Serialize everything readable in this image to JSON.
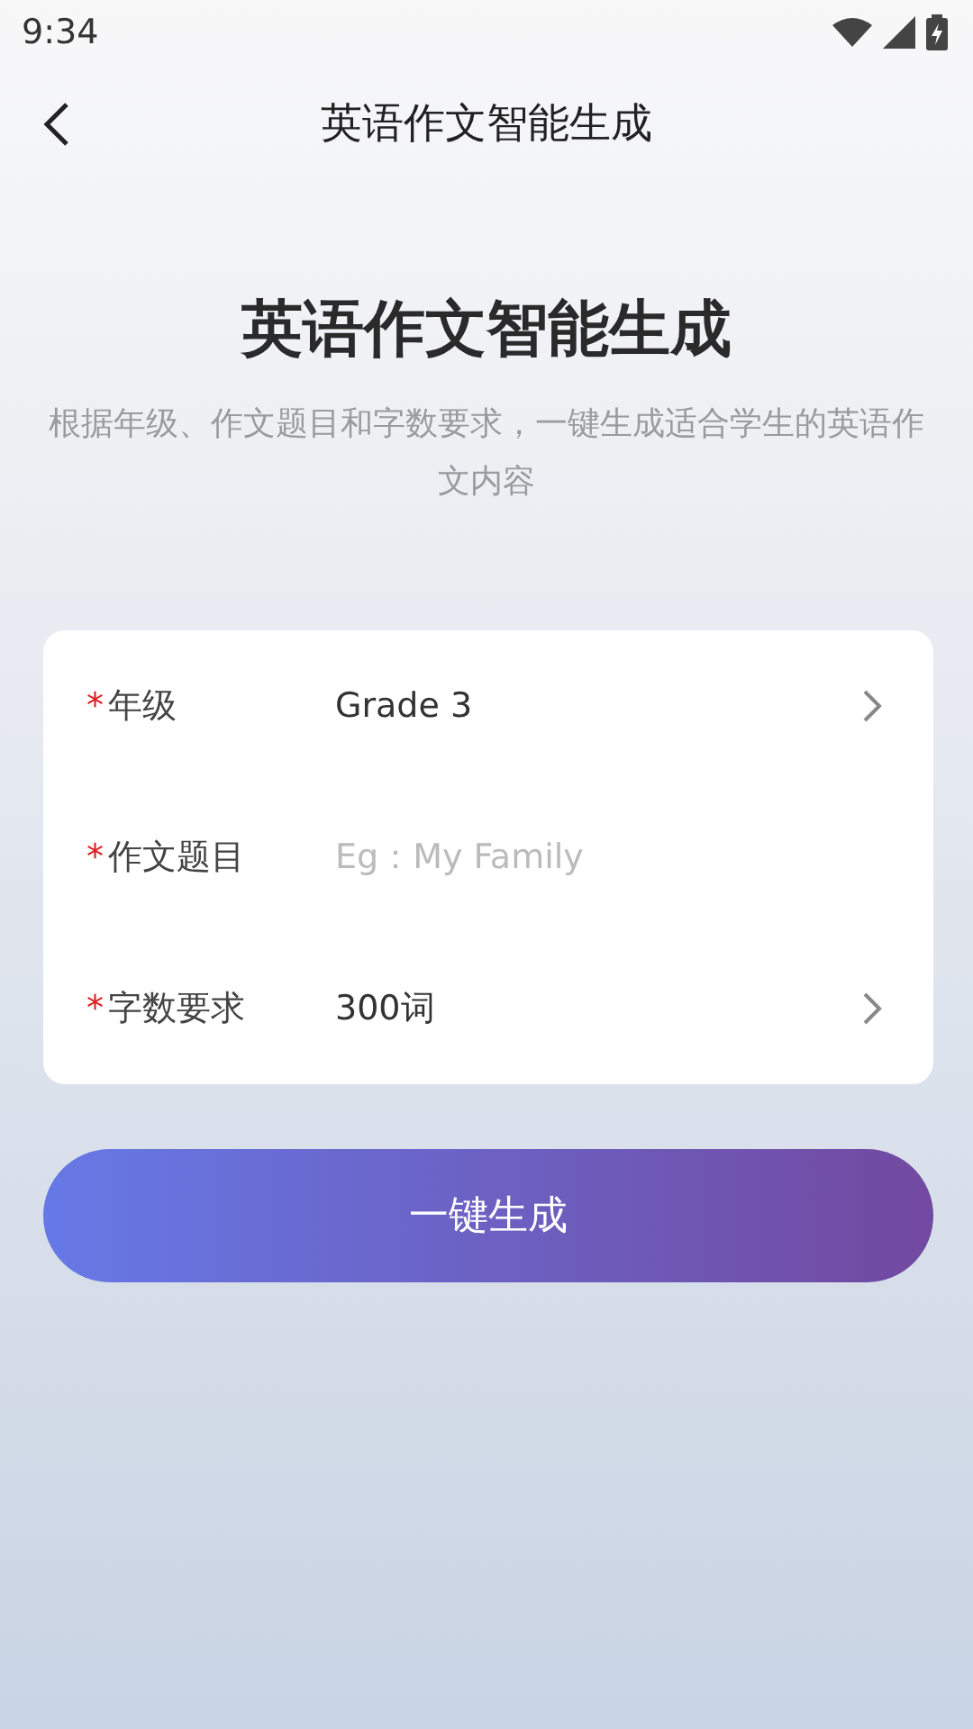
{
  "status_bar": {
    "time": "9:34"
  },
  "header": {
    "title": "英语作文智能生成"
  },
  "hero": {
    "title": "英语作文智能生成",
    "subtitle": "根据年级、作文题目和字数要求，一键生成适合学生的英语作文内容"
  },
  "form": {
    "fields": [
      {
        "kind": "select",
        "required_mark": "*",
        "label": "年级",
        "value": "Grade 3"
      },
      {
        "kind": "input",
        "required_mark": "*",
        "label": "作文题目",
        "placeholder": "Eg：My Family"
      },
      {
        "kind": "select",
        "required_mark": "*",
        "label": "字数要求",
        "value": "300词"
      }
    ]
  },
  "submit": {
    "label": "一键生成"
  }
}
